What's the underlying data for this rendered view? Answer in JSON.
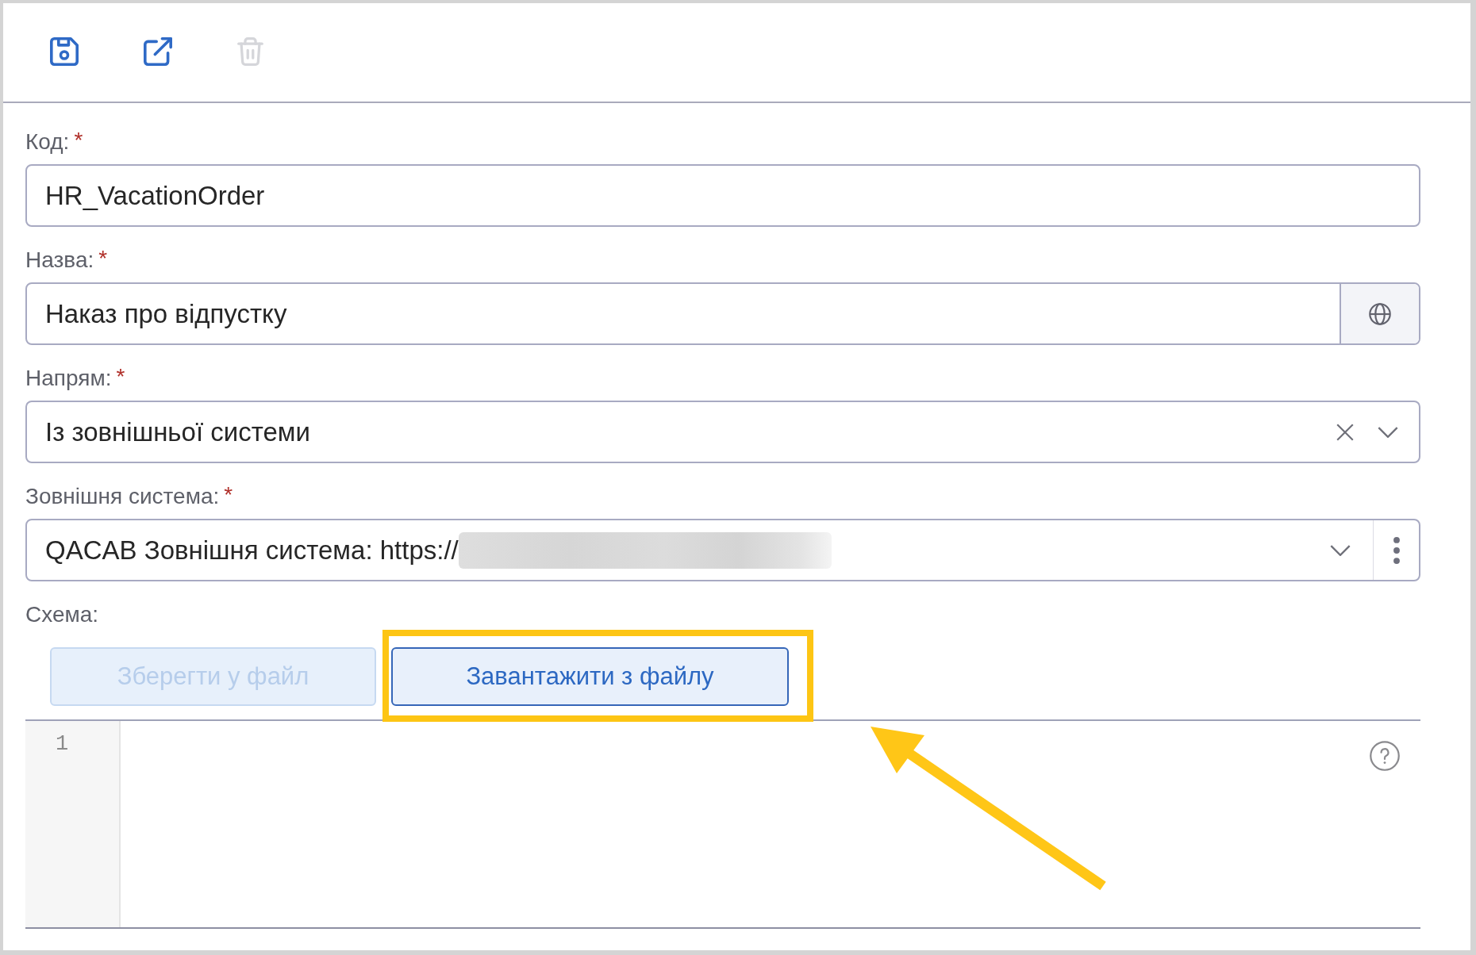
{
  "toolbar": [
    {
      "kind": "save",
      "disabled": false
    },
    {
      "kind": "open_external",
      "disabled": false
    },
    {
      "kind": "delete",
      "disabled": true
    }
  ],
  "fields": [
    {
      "kind": "text",
      "label": "Код:",
      "required_mark": "*",
      "value": "HR_VacationOrder",
      "redacted": false
    },
    {
      "kind": "localized",
      "label": "Назва:",
      "required_mark": "*",
      "value": "Наказ про відпустку",
      "redacted": false
    },
    {
      "kind": "select",
      "label": "Напрям:",
      "required_mark": "*",
      "value": "Із зовнішньої системи",
      "redacted": false
    },
    {
      "kind": "lookup",
      "label": "Зовнішня система:",
      "required_mark": "*",
      "value": "QACAB Зовнішня система: https://",
      "redacted": true
    }
  ],
  "schema": {
    "label": "Схема:",
    "buttons": [
      {
        "label": "Зберегти у файл",
        "disabled": true,
        "highlighted": false
      },
      {
        "label": "Завантажити з файлу",
        "disabled": false,
        "highlighted": true
      }
    ],
    "editor": {
      "line_numbers": [
        "1"
      ]
    }
  },
  "callout_arrow": true
}
